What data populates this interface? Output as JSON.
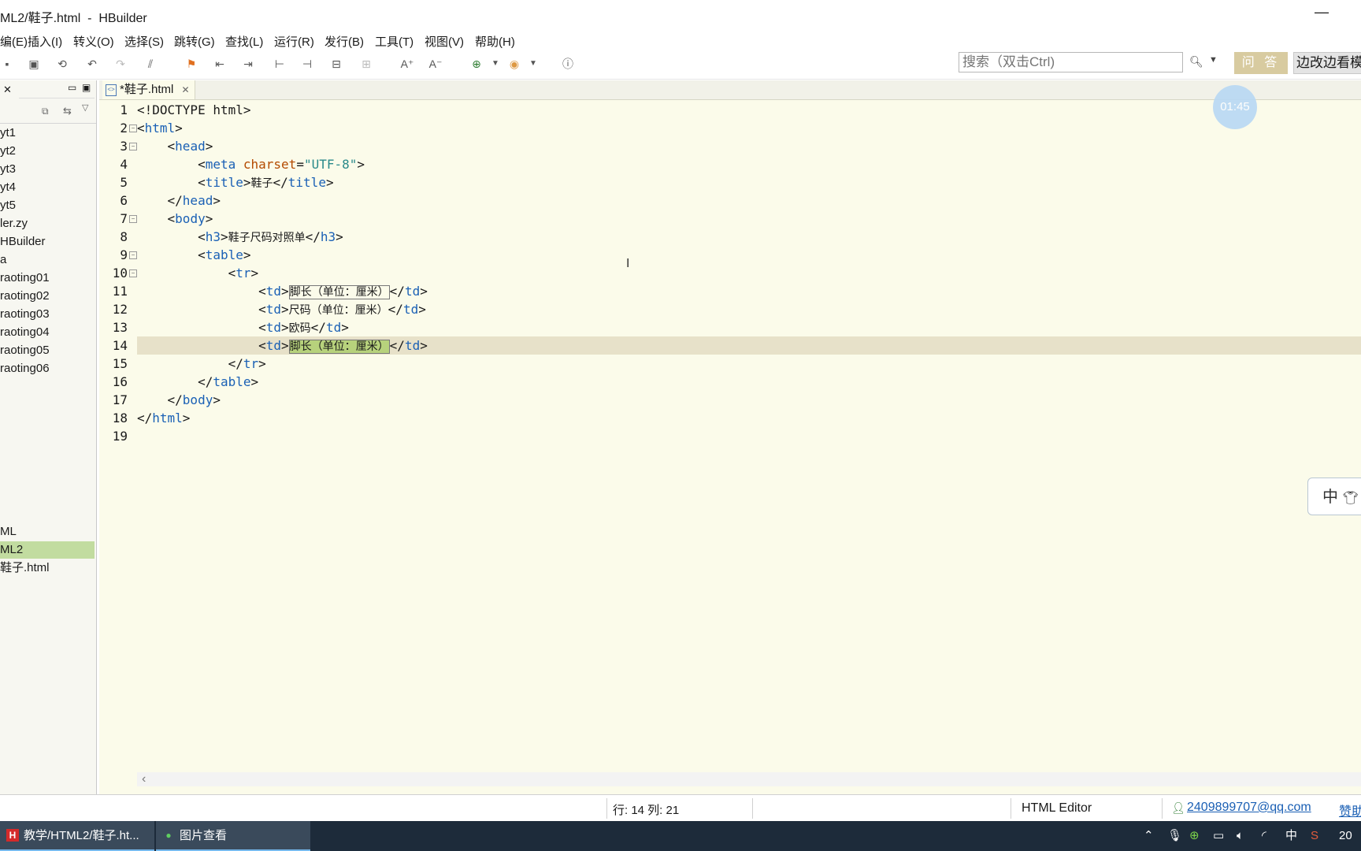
{
  "window": {
    "title": "ML2/鞋子.html  -  HBuilder",
    "minimize": "—"
  },
  "menu": [
    "编(E)",
    "插入(I)",
    "转义(O)",
    "选择(S)",
    "跳转(G)",
    "查找(L)",
    "运行(R)",
    "发行(B)",
    "工具(T)",
    "视图(V)",
    "帮助(H)"
  ],
  "toolbar": {
    "search_placeholder": "搜索（双击Ctrl)",
    "qa_label": "问 答",
    "side_label": "边改边看模"
  },
  "sidebar": {
    "items": [
      "yt1",
      "yt2",
      "yt3",
      "yt4",
      "yt5",
      "ler.zy",
      "HBuilder",
      "a",
      "raoting01",
      "raoting02",
      "raoting03",
      "raoting04",
      "raoting05",
      "raoting06"
    ],
    "bottom_items": [
      "ML",
      "ML2",
      "鞋子.html"
    ],
    "selected": "ML2"
  },
  "editor": {
    "tab_label": "*鞋子.html",
    "line_numbers": [
      "1",
      "2",
      "3",
      "4",
      "5",
      "6",
      "7",
      "8",
      "9",
      "10",
      "11",
      "12",
      "13",
      "14",
      "15",
      "16",
      "17",
      "18",
      "19"
    ],
    "code": {
      "l1": "<!DOCTYPE html>",
      "l2_tag": "html",
      "l3_tag": "head",
      "l4_tag": "meta",
      "l4_attr": "charset",
      "l4_val": "\"UTF-8\"",
      "l5_tag": "title",
      "l5_text": "鞋子",
      "l8_tag": "h3",
      "l8_text": "鞋子尺码对照单",
      "l9_tag": "table",
      "l10_tag": "tr",
      "td": "td",
      "l11_text": "脚长（单位：厘米）",
      "l12_text": "尺码（单位：厘米）",
      "l13_text": "欧码",
      "l14_text": "脚长（单位：厘米）",
      "body_tag": "body"
    },
    "timer": "01:45",
    "ime": "中"
  },
  "status": {
    "position": "行: 14 列: 21",
    "editor_name": "HTML Editor",
    "email": "2409899707@qq.com",
    "help": "赞助"
  },
  "taskbar": {
    "tasks": [
      "教学/HTML2/鞋子.ht...",
      "图片查看"
    ],
    "clock": "20",
    "ime_tray": "中"
  }
}
